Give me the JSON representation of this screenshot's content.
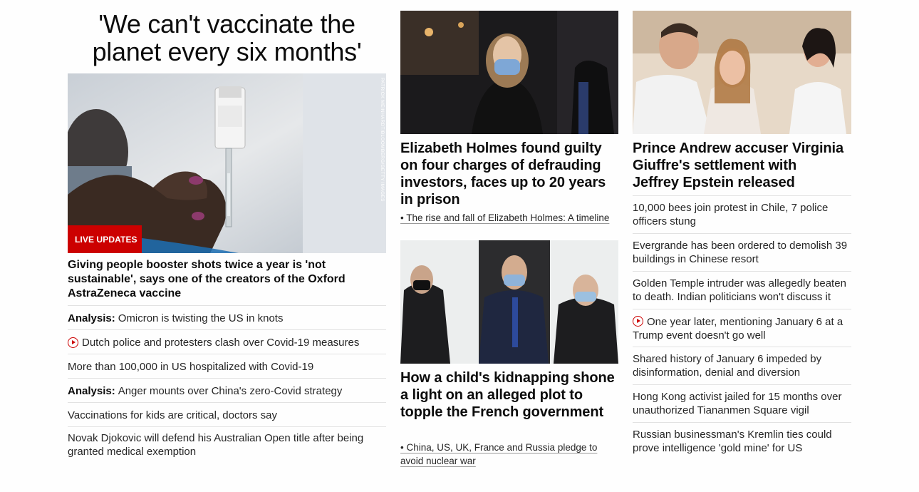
{
  "left": {
    "headline": "'We can't vaccinate the planet every six months'",
    "image_credit": "PATRICK MEINHARDT/BLOOMBERG/GETTY IMAGES",
    "badge": "LIVE UPDATES",
    "lead": "Giving people booster shots twice a year is 'not sustainable', says one of the creators of the Oxford AstraZeneca vaccine",
    "items": [
      {
        "prefix": "Analysis:",
        "text": "Omicron is twisting the US in knots",
        "video": false
      },
      {
        "prefix": "",
        "text": "Dutch police and protesters clash over Covid-19 measures",
        "video": true
      },
      {
        "prefix": "",
        "text": "More than 100,000 in US hospitalized with Covid-19",
        "video": false
      },
      {
        "prefix": "Analysis:",
        "text": "Anger mounts over China's zero-Covid strategy",
        "video": false
      },
      {
        "prefix": "",
        "text": "Vaccinations for kids are critical, doctors say",
        "video": false
      },
      {
        "prefix": "",
        "text": "Novak Djokovic will defend his Australian Open title after being granted medical exemption",
        "video": false
      }
    ]
  },
  "middle": {
    "story1": {
      "headline": "Elizabeth Holmes found guilty on four charges of defrauding investors, faces up to 20 years in prison",
      "sublink": "• The rise and fall of Elizabeth Holmes: A timeline"
    },
    "story2": {
      "headline": "How a child's kidnapping shone a light on an alleged plot to topple the French government",
      "sublink": "• China, US, UK, France and Russia pledge to avoid nuclear war"
    }
  },
  "right": {
    "headline": "Prince Andrew accuser Virginia Giuffre's settlement with Jeffrey Epstein released",
    "items": [
      {
        "text": "10,000 bees join protest in Chile, 7 police officers stung",
        "video": false
      },
      {
        "text": "Evergrande has been ordered to demolish 39 buildings in Chinese resort",
        "video": false
      },
      {
        "text": "Golden Temple intruder was allegedly beaten to death. Indian politicians won't discuss it",
        "video": false
      },
      {
        "text": "One year later, mentioning January 6 at a Trump event doesn't go well",
        "video": true
      },
      {
        "text": "Shared history of January 6 impeded by disinformation, denial and diversion",
        "video": false
      },
      {
        "text": "Hong Kong activist jailed for 15 months over unauthorized Tiananmen Square vigil",
        "video": false
      },
      {
        "text": "Russian businessman's Kremlin ties could prove intelligence 'gold mine' for US",
        "video": false
      }
    ]
  },
  "colors": {
    "badge": "#cc0000",
    "text": "#0c0c0c",
    "divider": "#e2e2e2"
  }
}
